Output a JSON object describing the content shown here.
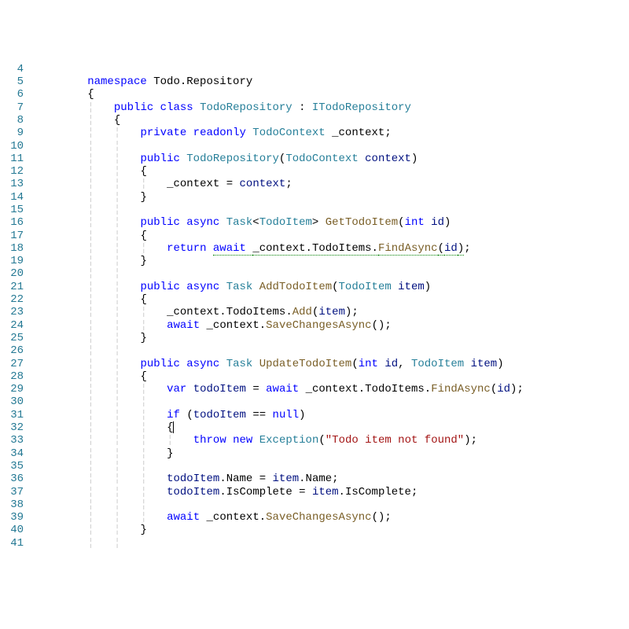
{
  "lines": [
    {
      "n": 4,
      "indent": 0,
      "tokens": []
    },
    {
      "n": 5,
      "indent": 0,
      "tokens": [
        {
          "t": "namespace ",
          "c": "c-kw"
        },
        {
          "t": "Todo",
          "c": "c-default"
        },
        {
          "t": ".",
          "c": "c-punc"
        },
        {
          "t": "Repository",
          "c": "c-default"
        }
      ]
    },
    {
      "n": 6,
      "indent": 0,
      "tokens": [
        {
          "t": "{",
          "c": "c-punc"
        }
      ]
    },
    {
      "n": 7,
      "indent": 1,
      "tokens": [
        {
          "t": "public class ",
          "c": "c-kw"
        },
        {
          "t": "TodoRepository",
          "c": "c-type"
        },
        {
          "t": " : ",
          "c": "c-punc"
        },
        {
          "t": "ITodoRepository",
          "c": "c-type"
        }
      ]
    },
    {
      "n": 8,
      "indent": 1,
      "tokens": [
        {
          "t": "{",
          "c": "c-punc"
        }
      ]
    },
    {
      "n": 9,
      "indent": 2,
      "tokens": [
        {
          "t": "private readonly ",
          "c": "c-kw"
        },
        {
          "t": "TodoContext",
          "c": "c-type"
        },
        {
          "t": " _context;",
          "c": "c-default"
        }
      ]
    },
    {
      "n": 10,
      "indent": 2,
      "tokens": []
    },
    {
      "n": 11,
      "indent": 2,
      "tokens": [
        {
          "t": "public ",
          "c": "c-kw"
        },
        {
          "t": "TodoRepository",
          "c": "c-type"
        },
        {
          "t": "(",
          "c": "c-punc"
        },
        {
          "t": "TodoContext",
          "c": "c-type"
        },
        {
          "t": " ",
          "c": "c-default"
        },
        {
          "t": "context",
          "c": "c-var"
        },
        {
          "t": ")",
          "c": "c-punc"
        }
      ]
    },
    {
      "n": 12,
      "indent": 2,
      "tokens": [
        {
          "t": "{",
          "c": "c-punc"
        }
      ]
    },
    {
      "n": 13,
      "indent": 3,
      "tokens": [
        {
          "t": "_context = ",
          "c": "c-default"
        },
        {
          "t": "context",
          "c": "c-var"
        },
        {
          "t": ";",
          "c": "c-punc"
        }
      ]
    },
    {
      "n": 14,
      "indent": 2,
      "tokens": [
        {
          "t": "}",
          "c": "c-punc"
        }
      ]
    },
    {
      "n": 15,
      "indent": 2,
      "tokens": []
    },
    {
      "n": 16,
      "indent": 2,
      "tokens": [
        {
          "t": "public async ",
          "c": "c-kw"
        },
        {
          "t": "Task",
          "c": "c-type"
        },
        {
          "t": "<",
          "c": "c-punc"
        },
        {
          "t": "TodoItem",
          "c": "c-type"
        },
        {
          "t": "> ",
          "c": "c-punc"
        },
        {
          "t": "GetTodoItem",
          "c": "c-method"
        },
        {
          "t": "(",
          "c": "c-punc"
        },
        {
          "t": "int ",
          "c": "c-kw"
        },
        {
          "t": "id",
          "c": "c-var"
        },
        {
          "t": ")",
          "c": "c-punc"
        }
      ]
    },
    {
      "n": 17,
      "indent": 2,
      "tokens": [
        {
          "t": "{",
          "c": "c-punc"
        }
      ]
    },
    {
      "n": 18,
      "indent": 3,
      "tokens": [
        {
          "t": "return ",
          "c": "c-kw"
        },
        {
          "t": "await ",
          "c": "c-kw underline-await"
        },
        {
          "t": "_context.TodoItems.",
          "c": "c-default underline-await"
        },
        {
          "t": "FindAsync",
          "c": "c-method underline-await"
        },
        {
          "t": "(",
          "c": "c-punc underline-await"
        },
        {
          "t": "id",
          "c": "c-var underline-await"
        },
        {
          "t": ")",
          "c": "c-punc underline-await"
        },
        {
          "t": ";",
          "c": "c-punc"
        }
      ]
    },
    {
      "n": 19,
      "indent": 2,
      "tokens": [
        {
          "t": "}",
          "c": "c-punc"
        }
      ]
    },
    {
      "n": 20,
      "indent": 2,
      "tokens": []
    },
    {
      "n": 21,
      "indent": 2,
      "tokens": [
        {
          "t": "public async ",
          "c": "c-kw"
        },
        {
          "t": "Task",
          "c": "c-type"
        },
        {
          "t": " ",
          "c": "c-default"
        },
        {
          "t": "AddTodoItem",
          "c": "c-method"
        },
        {
          "t": "(",
          "c": "c-punc"
        },
        {
          "t": "TodoItem",
          "c": "c-type"
        },
        {
          "t": " ",
          "c": "c-default"
        },
        {
          "t": "item",
          "c": "c-var"
        },
        {
          "t": ")",
          "c": "c-punc"
        }
      ]
    },
    {
      "n": 22,
      "indent": 2,
      "tokens": [
        {
          "t": "{",
          "c": "c-punc"
        }
      ]
    },
    {
      "n": 23,
      "indent": 3,
      "tokens": [
        {
          "t": "_context.TodoItems.",
          "c": "c-default"
        },
        {
          "t": "Add",
          "c": "c-method"
        },
        {
          "t": "(",
          "c": "c-punc"
        },
        {
          "t": "item",
          "c": "c-var"
        },
        {
          "t": ");",
          "c": "c-punc"
        }
      ]
    },
    {
      "n": 24,
      "indent": 3,
      "tokens": [
        {
          "t": "await ",
          "c": "c-kw"
        },
        {
          "t": "_context.",
          "c": "c-default"
        },
        {
          "t": "SaveChangesAsync",
          "c": "c-method"
        },
        {
          "t": "();",
          "c": "c-punc"
        }
      ]
    },
    {
      "n": 25,
      "indent": 2,
      "tokens": [
        {
          "t": "}",
          "c": "c-punc"
        }
      ]
    },
    {
      "n": 26,
      "indent": 2,
      "tokens": []
    },
    {
      "n": 27,
      "indent": 2,
      "tokens": [
        {
          "t": "public async ",
          "c": "c-kw"
        },
        {
          "t": "Task",
          "c": "c-type"
        },
        {
          "t": " ",
          "c": "c-default"
        },
        {
          "t": "UpdateTodoItem",
          "c": "c-method"
        },
        {
          "t": "(",
          "c": "c-punc"
        },
        {
          "t": "int ",
          "c": "c-kw"
        },
        {
          "t": "id",
          "c": "c-var"
        },
        {
          "t": ", ",
          "c": "c-punc"
        },
        {
          "t": "TodoItem",
          "c": "c-type"
        },
        {
          "t": " ",
          "c": "c-default"
        },
        {
          "t": "item",
          "c": "c-var"
        },
        {
          "t": ")",
          "c": "c-punc"
        }
      ]
    },
    {
      "n": 28,
      "indent": 2,
      "tokens": [
        {
          "t": "{",
          "c": "c-punc"
        }
      ]
    },
    {
      "n": 29,
      "indent": 3,
      "tokens": [
        {
          "t": "var ",
          "c": "c-kw"
        },
        {
          "t": "todoItem",
          "c": "c-var"
        },
        {
          "t": " = ",
          "c": "c-punc"
        },
        {
          "t": "await ",
          "c": "c-kw"
        },
        {
          "t": "_context.TodoItems.",
          "c": "c-default"
        },
        {
          "t": "FindAsync",
          "c": "c-method"
        },
        {
          "t": "(",
          "c": "c-punc"
        },
        {
          "t": "id",
          "c": "c-var"
        },
        {
          "t": ");",
          "c": "c-punc"
        }
      ]
    },
    {
      "n": 30,
      "indent": 3,
      "tokens": []
    },
    {
      "n": 31,
      "indent": 3,
      "tokens": [
        {
          "t": "if ",
          "c": "c-kw"
        },
        {
          "t": "(",
          "c": "c-punc"
        },
        {
          "t": "todoItem",
          "c": "c-var"
        },
        {
          "t": " == ",
          "c": "c-punc"
        },
        {
          "t": "null",
          "c": "c-kw"
        },
        {
          "t": ")",
          "c": "c-punc"
        }
      ]
    },
    {
      "n": 32,
      "indent": 3,
      "tokens": [
        {
          "t": "{",
          "c": "c-punc"
        },
        {
          "t": "CURSOR",
          "c": "cursor-marker"
        }
      ]
    },
    {
      "n": 33,
      "indent": 4,
      "tokens": [
        {
          "t": "throw new ",
          "c": "c-kw"
        },
        {
          "t": "Exception",
          "c": "c-type"
        },
        {
          "t": "(",
          "c": "c-punc"
        },
        {
          "t": "\"Todo item not found\"",
          "c": "c-str"
        },
        {
          "t": ");",
          "c": "c-punc"
        }
      ]
    },
    {
      "n": 34,
      "indent": 3,
      "tokens": [
        {
          "t": "}",
          "c": "c-punc"
        }
      ]
    },
    {
      "n": 35,
      "indent": 3,
      "tokens": []
    },
    {
      "n": 36,
      "indent": 3,
      "tokens": [
        {
          "t": "todoItem",
          "c": "c-var"
        },
        {
          "t": ".Name = ",
          "c": "c-default"
        },
        {
          "t": "item",
          "c": "c-var"
        },
        {
          "t": ".Name;",
          "c": "c-default"
        }
      ]
    },
    {
      "n": 37,
      "indent": 3,
      "tokens": [
        {
          "t": "todoItem",
          "c": "c-var"
        },
        {
          "t": ".IsComplete = ",
          "c": "c-default"
        },
        {
          "t": "item",
          "c": "c-var"
        },
        {
          "t": ".IsComplete;",
          "c": "c-default"
        }
      ]
    },
    {
      "n": 38,
      "indent": 3,
      "tokens": []
    },
    {
      "n": 39,
      "indent": 3,
      "tokens": [
        {
          "t": "await ",
          "c": "c-kw"
        },
        {
          "t": "_context.",
          "c": "c-default"
        },
        {
          "t": "SaveChangesAsync",
          "c": "c-method"
        },
        {
          "t": "();",
          "c": "c-punc"
        }
      ]
    },
    {
      "n": 40,
      "indent": 2,
      "tokens": [
        {
          "t": "}",
          "c": "c-punc"
        }
      ]
    },
    {
      "n": 41,
      "indent": 2,
      "tokens": []
    }
  ],
  "baseIndentSpaces": "        ",
  "indentUnit": "    "
}
